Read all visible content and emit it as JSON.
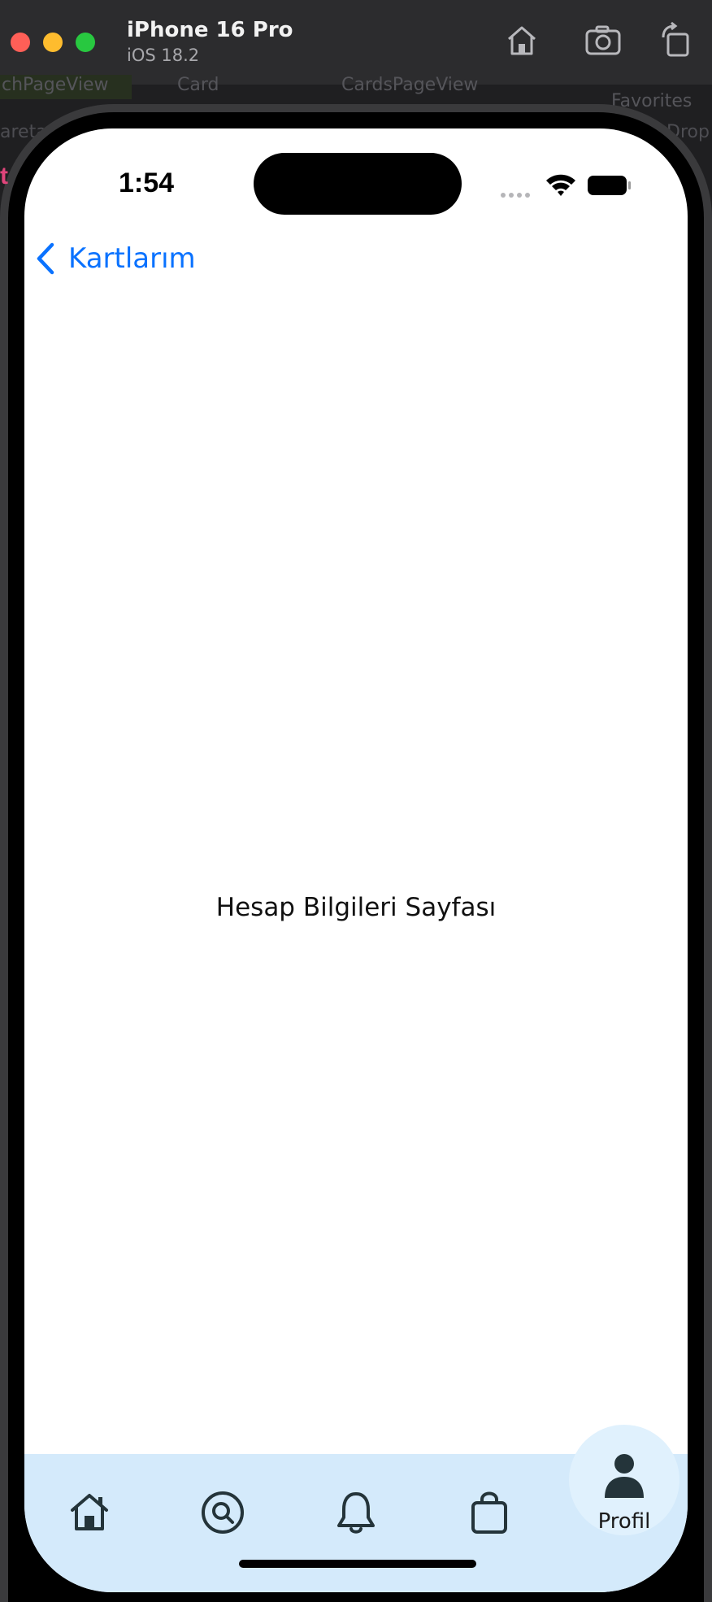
{
  "simulator": {
    "device_name": "iPhone 16 Pro",
    "os_version": "iOS 18.2",
    "toolbar_icons": [
      "home-icon",
      "screenshot-icon",
      "rotate-icon"
    ]
  },
  "background_tabs": [
    "chPageView",
    "Card",
    "CardsPageView",
    "Favorites",
    "aretan",
    "Drop"
  ],
  "status_bar": {
    "time": "1:54"
  },
  "nav": {
    "back_label": "Kartlarım"
  },
  "content": {
    "title": "Hesap Bilgileri Sayfası"
  },
  "tab_bar": {
    "items": [
      {
        "icon": "home-icon"
      },
      {
        "icon": "search-icon"
      },
      {
        "icon": "bell-icon"
      },
      {
        "icon": "bag-icon"
      },
      {
        "icon": "person-icon",
        "label": "Profil",
        "selected": true
      }
    ]
  },
  "colors": {
    "accent": "#0a72ff",
    "tab_bar_bg": "#d4eafb",
    "icon": "#24343a"
  }
}
